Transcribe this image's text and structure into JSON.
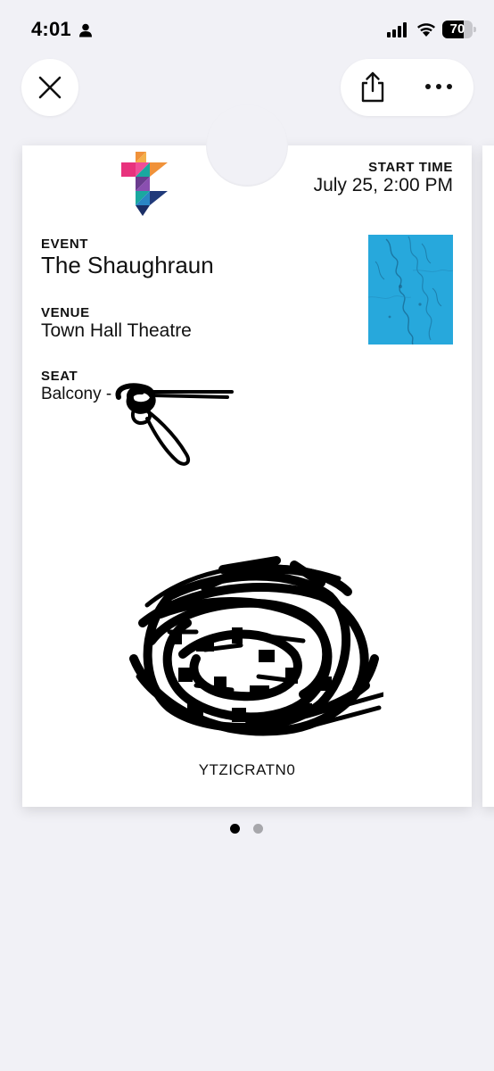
{
  "status_bar": {
    "time": "4:01",
    "battery_percent": "70",
    "battery_level": 0.7,
    "icons": [
      "person-icon",
      "signal-icon",
      "wifi-icon",
      "battery-icon"
    ]
  },
  "toolbar": {
    "close_icon": "close-icon",
    "share_icon": "share-icon",
    "more_icon": "more-icon"
  },
  "pass": {
    "start_time_label": "START TIME",
    "start_time_value": "July 25, 2:00 PM",
    "event_label": "EVENT",
    "event_value": "The Shaughraun",
    "venue_label": "VENUE",
    "venue_value": "Town Hall Theatre",
    "seat_label": "SEAT",
    "seat_value": "Balcony -",
    "barcode_text": "YTZICRATN0"
  },
  "pagination": {
    "current_page": 1,
    "total_pages": 2
  },
  "colors": {
    "background": "#f1f1f6",
    "map_blue": "#27a8dc",
    "logo_pink": "#e8327d",
    "logo_orange": "#f0923a",
    "logo_teal": "#1aa8a0",
    "logo_purple": "#6a3c8e",
    "logo_navy": "#203a7a"
  }
}
